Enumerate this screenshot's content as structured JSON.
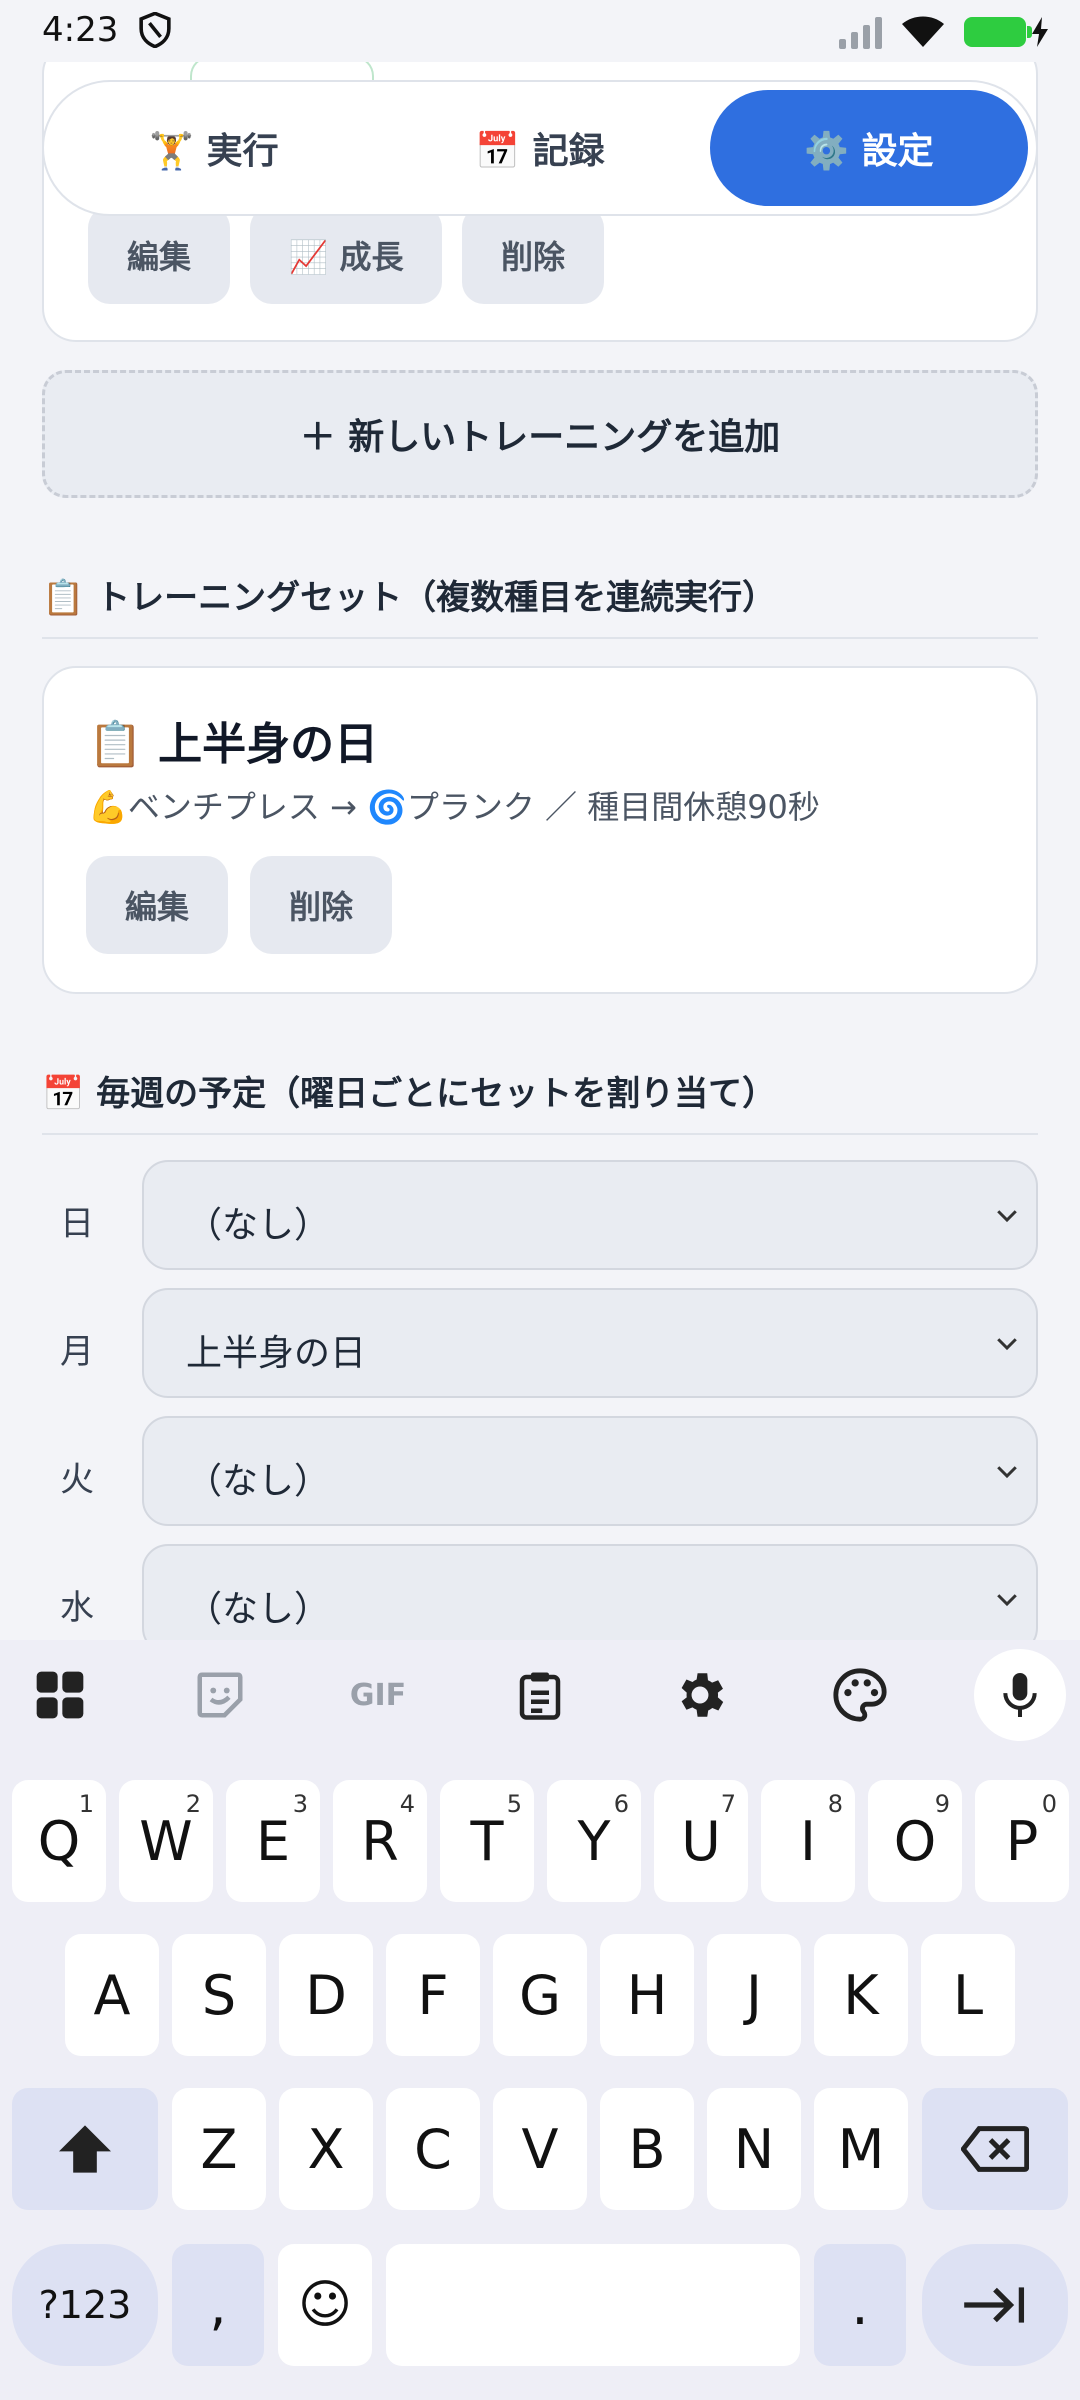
{
  "status": {
    "time": "4:23"
  },
  "tabs": [
    {
      "label": "🏋️ 実行"
    },
    {
      "label": "📅 記録"
    },
    {
      "label": "⚙️ 設定"
    }
  ],
  "exercise_card": {
    "buttons": {
      "edit": "編集",
      "growth": "📈 成長",
      "delete": "削除"
    }
  },
  "add_training_label": "＋ 新しいトレーニングを追加",
  "sets_section": {
    "heading": "📋 トレーニングセット（複数種目を連続実行）",
    "set": {
      "title": "📋 上半身の日",
      "detail": "💪ベンチプレス → 🌀プランク ／ 種目間休憩90秒",
      "edit": "編集",
      "delete": "削除"
    }
  },
  "schedule_section": {
    "heading": "📅 毎週の予定（曜日ごとにセットを割り当て）",
    "days": [
      {
        "day": "日",
        "value": "（なし）"
      },
      {
        "day": "月",
        "value": "上半身の日"
      },
      {
        "day": "火",
        "value": "（なし）"
      },
      {
        "day": "水",
        "value": "（なし）"
      }
    ]
  },
  "keyboard": {
    "toolbar": {
      "gif": "GIF"
    },
    "row1": [
      {
        "key": "Q",
        "num": "1"
      },
      {
        "key": "W",
        "num": "2"
      },
      {
        "key": "E",
        "num": "3"
      },
      {
        "key": "R",
        "num": "4"
      },
      {
        "key": "T",
        "num": "5"
      },
      {
        "key": "Y",
        "num": "6"
      },
      {
        "key": "U",
        "num": "7"
      },
      {
        "key": "I",
        "num": "8"
      },
      {
        "key": "O",
        "num": "9"
      },
      {
        "key": "P",
        "num": "0"
      }
    ],
    "row2": [
      "A",
      "S",
      "D",
      "F",
      "G",
      "H",
      "J",
      "K",
      "L"
    ],
    "row3": [
      "Z",
      "X",
      "C",
      "V",
      "B",
      "N",
      "M"
    ],
    "symbols": "?123",
    "comma": ",",
    "period": ".",
    "emoji": "☺"
  }
}
